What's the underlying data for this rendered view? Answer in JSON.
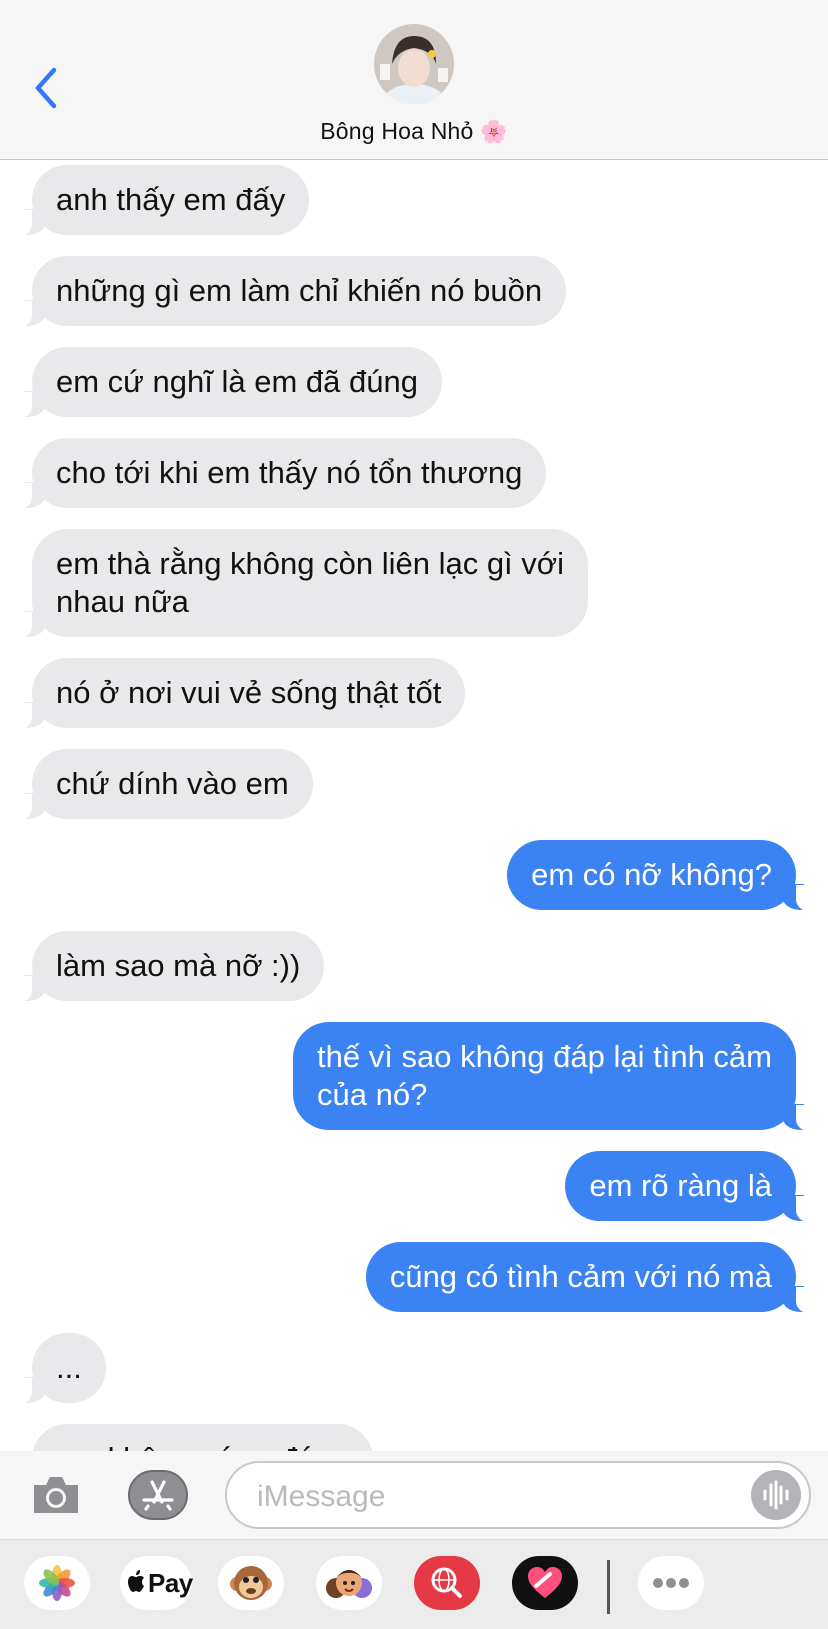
{
  "header": {
    "contact_name": "Bông Hoa Nhỏ",
    "contact_emoji": "🌸"
  },
  "messages": [
    {
      "direction": "in",
      "text": "anh thấy em đấy"
    },
    {
      "direction": "in",
      "text": "những gì em làm chỉ khiến nó buồn"
    },
    {
      "direction": "in",
      "text": "em cứ nghĩ là em đã đúng"
    },
    {
      "direction": "in",
      "text": "cho tới khi em thấy nó tổn thương"
    },
    {
      "direction": "in",
      "text": "em thà rằng không còn liên lạc gì với\nnhau nữa"
    },
    {
      "direction": "in",
      "text": "nó ở nơi vui vẻ sống thật tốt"
    },
    {
      "direction": "in",
      "text": "chứ dính vào em"
    },
    {
      "direction": "out",
      "text": "em có nỡ không?"
    },
    {
      "direction": "in",
      "text": "làm sao mà nỡ :))"
    },
    {
      "direction": "out",
      "text": "thế vì sao không đáp lại tình cảm\ncủa nó?"
    },
    {
      "direction": "out",
      "text": "em rõ ràng là"
    },
    {
      "direction": "out",
      "text": "cũng có tình cảm với nó mà"
    },
    {
      "direction": "in",
      "text": "..."
    },
    {
      "direction": "in",
      "text": "em không xứng đáng"
    }
  ],
  "input": {
    "placeholder": "iMessage"
  },
  "drawer": {
    "apps": [
      "photos-icon",
      "apple-pay-icon",
      "animoji-icon",
      "memoji-icon",
      "web-search-icon",
      "digital-touch-icon",
      "more-icon"
    ],
    "pay_label": "Pay"
  },
  "colors": {
    "outgoing": "#3b82f3",
    "incoming": "#e9e9eb",
    "accent": "#3478f6"
  }
}
